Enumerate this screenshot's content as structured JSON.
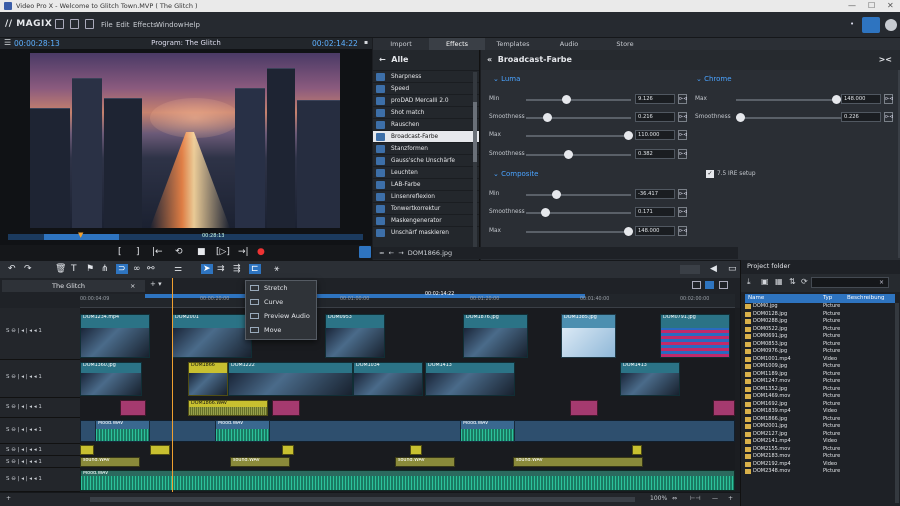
{
  "window": {
    "title": "Video Pro X - Welcome to Glitch Town.MVP ( The Glitch )",
    "controls": [
      "—",
      "☐",
      "✕"
    ]
  },
  "menubar": {
    "logo": "// MAGIX",
    "menus": [
      "File",
      "Edit",
      "Effects",
      "Window",
      "Help"
    ]
  },
  "player": {
    "timecode_left": "00:00:28:13",
    "title": "Program: The Glitch",
    "timecode_right": "00:02:14:22",
    "scrub_timecode": "00:28:13",
    "progress_fraction": 0.21
  },
  "transport": {
    "buttons": [
      "[",
      "]",
      "|←",
      "⟲",
      "■",
      "[▷]",
      "→|",
      "●"
    ]
  },
  "tabs": [
    "Import",
    "Effects",
    "Templates",
    "Audio",
    "Store"
  ],
  "effects": {
    "header": "Alle",
    "back_arrow": "←",
    "items": [
      "Sharpness",
      "Speed",
      "proDAD Mercalli 2.0",
      "Shot match",
      "Rauschen",
      "Broadcast-Farbe",
      "Stanzformen",
      "Gauss'sche Unschärfe",
      "Leuchten",
      "LAB-Farbe",
      "Linsenreflexion",
      "Tonwertkorrektur",
      "Maskengenerator",
      "Unschärf maskieren"
    ],
    "selected_index": 5
  },
  "broadcast": {
    "title": "Broadcast-Farbe",
    "luma": {
      "label": "Luma",
      "rows": [
        {
          "label": "Min",
          "value": "9.126"
        },
        {
          "label": "Smoothness",
          "value": "0.216"
        },
        {
          "label": "Max",
          "value": "110.000"
        },
        {
          "label": "Smoothness",
          "value": "0.382"
        }
      ]
    },
    "chroma": {
      "label": "Chrome",
      "rows": [
        {
          "label": "Max",
          "value": "148.000"
        },
        {
          "label": "Smoothness",
          "value": "0.226"
        }
      ]
    },
    "composite": {
      "label": "Composite",
      "rows": [
        {
          "label": "Min",
          "value": "-36.417"
        },
        {
          "label": "Smoothness",
          "value": "0.171"
        },
        {
          "label": "Max",
          "value": "148.000"
        }
      ]
    },
    "ire_setup": "7.5 IRE setup"
  },
  "effect_nav": {
    "file": "DOM1866.jpg"
  },
  "timeline": {
    "tab": "The Glitch",
    "ruler_labels": [
      "00:00:04:09",
      "00:00:20:00",
      "00:01:00:00",
      "00:01:20:00",
      "00:01:40:00",
      "00:02:00:00"
    ],
    "ruler_center": "00:02:14:22"
  },
  "context_menu": [
    "Stretch",
    "Curve",
    "Preview Audio",
    "Move"
  ],
  "track_controls": "S ⊖ | ◂ | ◂ ◂ 1",
  "clips": {
    "v1": [
      "DOM1234.mp4",
      "DOM2001",
      "DOM0953",
      "DOM1876.jpg",
      "DOM1385.jpg",
      "DOM0791.jpg"
    ],
    "v2": [
      "DOM1360.jpg",
      "DOM1866",
      "DOM1222",
      "DOM1034",
      "DOM1413",
      "DOM1413"
    ],
    "a3": [
      "DOM1866.WAV"
    ],
    "a4": [
      "Mood.WAV",
      "Mood.WAV",
      "Mood.WAV"
    ],
    "a6": [
      "sound.WAV",
      "sound.WAV",
      "sound.WAV",
      "sound.WAV"
    ],
    "a7": [
      "Mood.WAV"
    ]
  },
  "bottom": {
    "zoom": "100%"
  },
  "project_folder": {
    "title": "Project folder",
    "columns": [
      "Name",
      "Typ",
      "Beschreibung"
    ],
    "files": [
      [
        "DOM0.jpg",
        "Picture"
      ],
      [
        "DOM0128.jpg",
        "Picture"
      ],
      [
        "DOM0288.jpg",
        "Picture"
      ],
      [
        "DOM0522.jpg",
        "Picture"
      ],
      [
        "DOM0691.jpg",
        "Picture"
      ],
      [
        "DOM0853.jpg",
        "Picture"
      ],
      [
        "DOM0976.jpg",
        "Picture"
      ],
      [
        "DOM1001.mp4",
        "Video"
      ],
      [
        "DOM1009.jpg",
        "Picture"
      ],
      [
        "DOM1189.jpg",
        "Picture"
      ],
      [
        "DOM1247.mov",
        "Picture"
      ],
      [
        "DOM1352.jpg",
        "Picture"
      ],
      [
        "DOM1469.mov",
        "Picture"
      ],
      [
        "DOM1692.jpg",
        "Picture"
      ],
      [
        "DOM1839.mp4",
        "Video"
      ],
      [
        "DOM1866.jpg",
        "Picture"
      ],
      [
        "DOM2001.jpg",
        "Picture"
      ],
      [
        "DOM2127.jpg",
        "Picture"
      ],
      [
        "DOM2141.mp4",
        "Video"
      ],
      [
        "DOM2155.mov",
        "Picture"
      ],
      [
        "DOM2183.mov",
        "Picture"
      ],
      [
        "DOM2192.mp4",
        "Video"
      ],
      [
        "DOM2348.mov",
        "Picture"
      ]
    ]
  },
  "colors": {
    "accent": "#2e74c0",
    "highlight": "#4aa3ff",
    "playhead": "#f0a030"
  }
}
